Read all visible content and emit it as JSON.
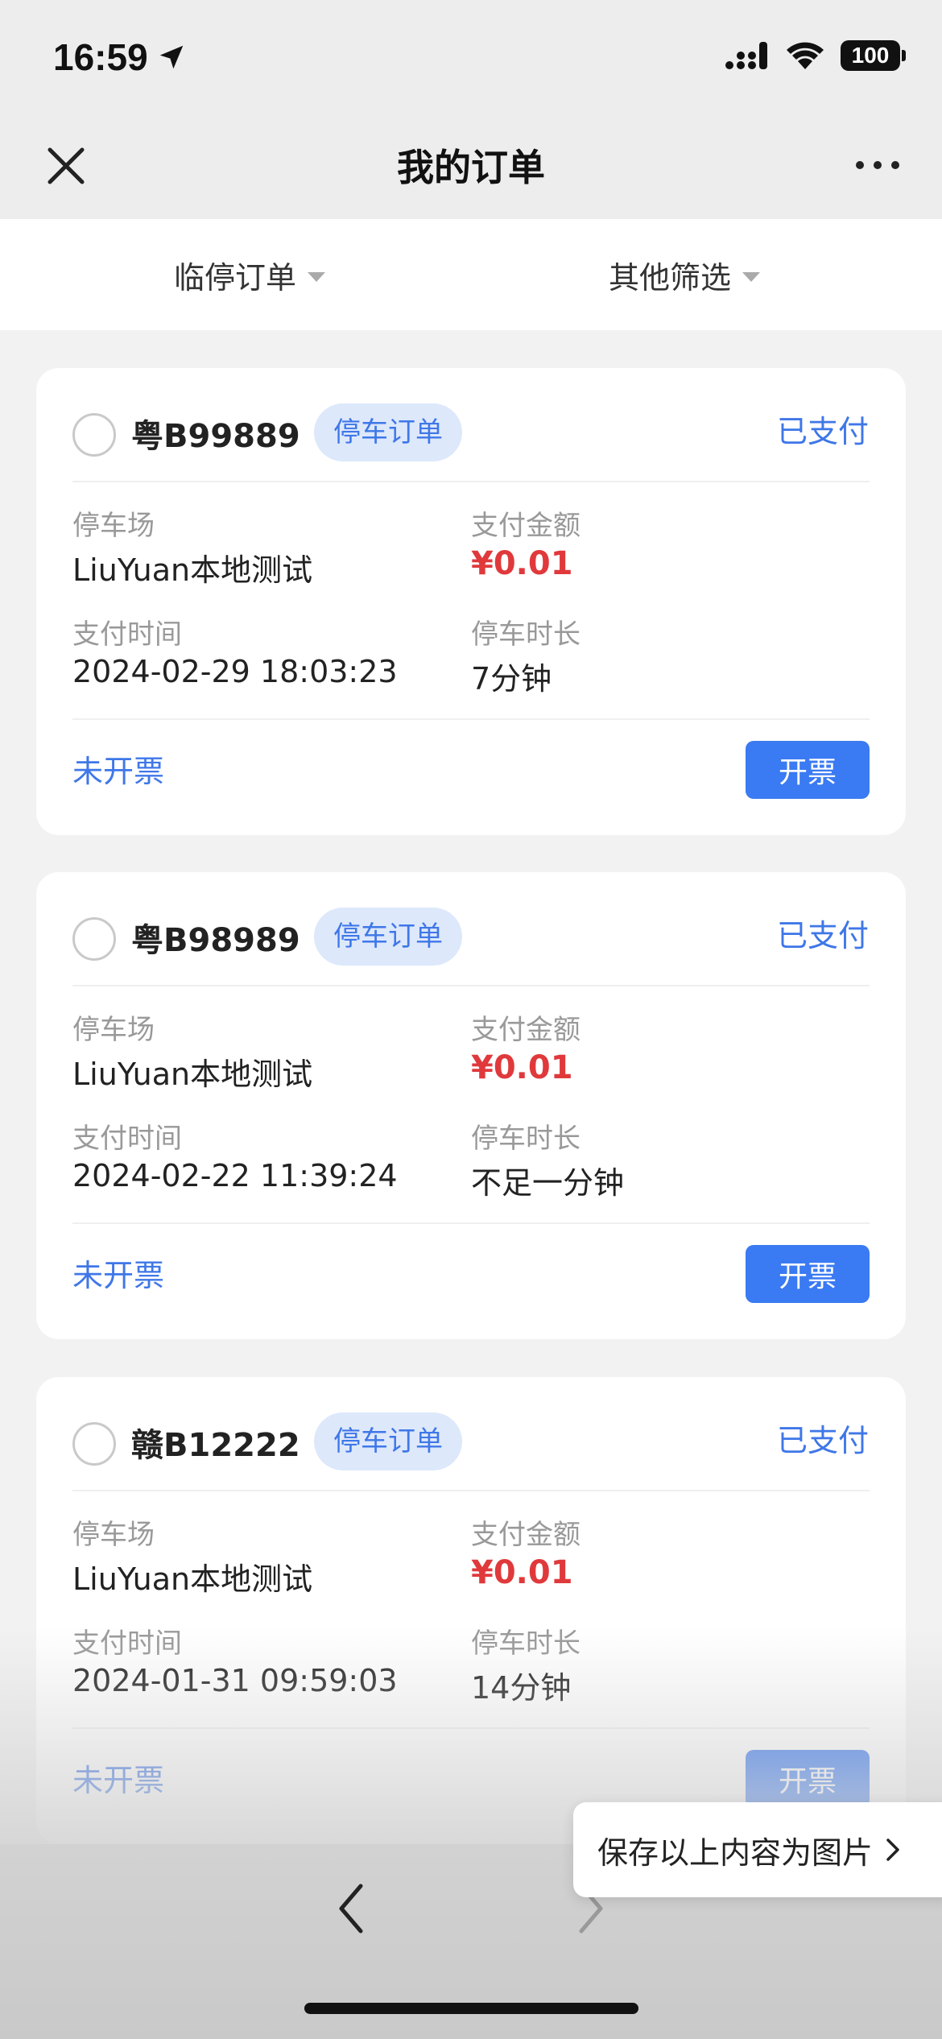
{
  "status_bar": {
    "time": "16:59",
    "battery": "100"
  },
  "nav": {
    "title": "我的订单"
  },
  "filters": [
    {
      "label": "临停订单"
    },
    {
      "label": "其他筛选"
    }
  ],
  "labels": {
    "parking_lot": "停车场",
    "pay_amount": "支付金额",
    "pay_time": "支付时间",
    "duration": "停车时长"
  },
  "orders": [
    {
      "plate": "粤B99889",
      "tag": "停车订单",
      "status": "已支付",
      "parking_lot": "LiuYuan本地测试",
      "amount": "¥0.01",
      "pay_time": "2024-02-29 18:03:23",
      "duration": "7分钟",
      "invoice_status": "未开票",
      "invoice_button": "开票"
    },
    {
      "plate": "粤B98989",
      "tag": "停车订单",
      "status": "已支付",
      "parking_lot": "LiuYuan本地测试",
      "amount": "¥0.01",
      "pay_time": "2024-02-22 11:39:24",
      "duration": "不足一分钟",
      "invoice_status": "未开票",
      "invoice_button": "开票"
    },
    {
      "plate": "赣B12222",
      "tag": "停车订单",
      "status": "已支付",
      "parking_lot": "LiuYuan本地测试",
      "amount": "¥0.01",
      "pay_time": "2024-01-31 09:59:03",
      "duration": "14分钟",
      "invoice_status": "未开票",
      "invoice_button": "开票"
    }
  ],
  "save_popup": {
    "label": "保存以上内容为图片"
  }
}
